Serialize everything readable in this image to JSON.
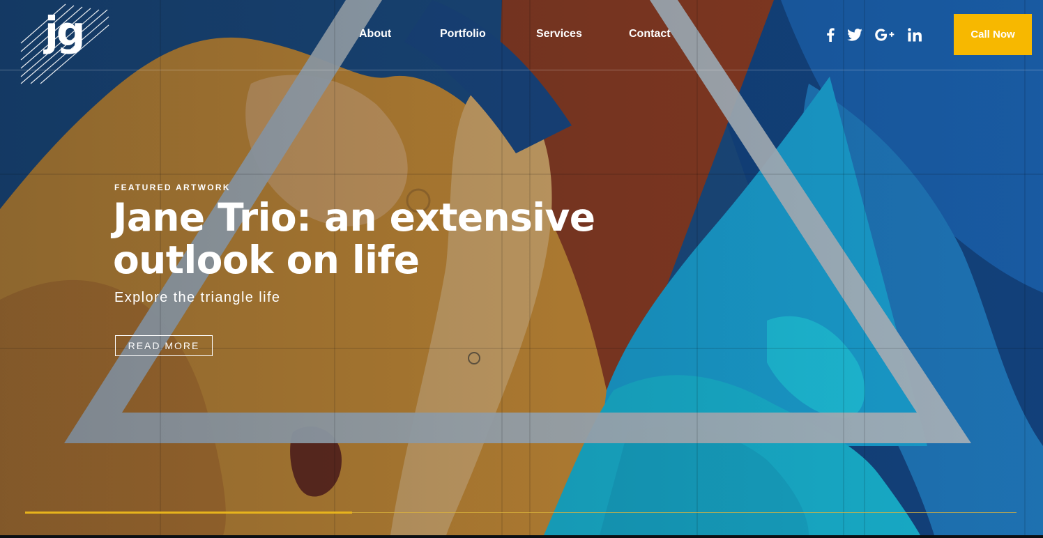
{
  "brand": {
    "logo_text": "jg"
  },
  "nav": {
    "items": [
      {
        "label": "About"
      },
      {
        "label": "Portfolio"
      },
      {
        "label": "Services"
      },
      {
        "label": "Contact"
      }
    ]
  },
  "social": [
    "facebook-icon",
    "twitter-icon",
    "google-plus-icon",
    "linkedin-icon"
  ],
  "header": {
    "cta_label": "Call Now"
  },
  "hero": {
    "eyebrow": "FEATURED ARTWORK",
    "headline": "Jane Trio: an extensive outlook on life",
    "subheading": "Explore the triangle life",
    "button_label": "READ MORE"
  },
  "slider": {
    "progress": 0.33
  },
  "colors": {
    "accent": "#f7b800",
    "progress": "#e8b41c",
    "text": "#ffffff"
  }
}
